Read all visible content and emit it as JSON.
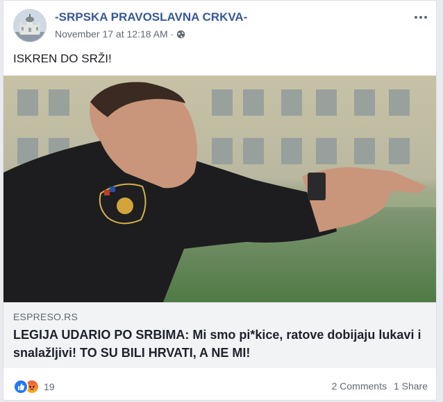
{
  "post": {
    "page_name": "-SRPSKA PRAVOSLAVNA CRKVA-",
    "timestamp": "November 17 at 12:18 AM",
    "separator": "·",
    "privacy_icon": "globe-icon",
    "menu_icon": "more-options-icon",
    "text": "ISKREN DO SRŽI!"
  },
  "link": {
    "domain": "ESPRESO.RS",
    "title": "LEGIJA UDARIO PO SRBIMA: Mi smo pi*kice, ratove dobijaju lukavi i snalažljivi! TO SU BILI HRVATI, A NE MI!"
  },
  "footer": {
    "reaction_icons": [
      "like-icon",
      "angry-icon"
    ],
    "reaction_count": "19",
    "comments": "2 Comments",
    "shares": "1 Share"
  },
  "colors": {
    "brand_link": "#385898",
    "secondary_text": "#606770",
    "like_blue": "#2078f4"
  }
}
